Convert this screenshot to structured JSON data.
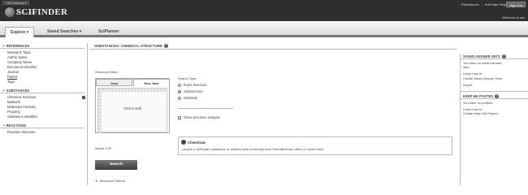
{
  "header": {
    "cas_chip": "CAS Solutions ▾",
    "logo_text": "SCIFINDER",
    "logo_sub": "A CAS SOLUTION",
    "links": [
      "Preferences",
      "SciFinder Help ▾"
    ],
    "separator": "|",
    "sign_out": "Sign Out",
    "welcome": "Welcome  liu yan"
  },
  "nav": {
    "tabs": [
      {
        "label": "Explore ▾",
        "active": true
      },
      {
        "label": "Saved Searches ▾",
        "active": false
      },
      {
        "label": "SciPlanner",
        "active": false
      }
    ]
  },
  "sidebar": {
    "references": {
      "title": "REFERENCES",
      "items": [
        "Research Topic",
        "Author Name",
        "Company Name",
        "Document Identifier",
        "Journal",
        "Patent",
        "Tags"
      ]
    },
    "substances": {
      "title": "SUBSTANCES",
      "items": [
        "Chemical Structure",
        "Markush",
        "Molecular Formula",
        "Property",
        "Substance Identifier"
      ]
    },
    "reactions": {
      "title": "REACTIONS",
      "items": [
        "Reaction Structure"
      ]
    }
  },
  "main": {
    "title": "SUBSTANCES: CHEMICAL STRUCTURE",
    "structure_editor_label": "Structure Editor:",
    "editor_tabs": [
      "Java",
      "Non-Java"
    ],
    "click_to_edit": "Click to Edit",
    "search_type_label": "Search Type:",
    "search_types": [
      {
        "label": "Exact Structure",
        "checked": false
      },
      {
        "label": "Substructure",
        "checked": true
      },
      {
        "label": "Similarity",
        "checked": false
      }
    ],
    "precision_label": "Show precision analysis",
    "chemdraw_title": "ChemDraw",
    "chemdraw_text": "Launch a SciFinder substance or reaction search directly from ChemBioDraw Ultra 14. Learn More",
    "import_cxf": "Import CXF",
    "search_button": "Search",
    "advanced_search": "Advanced Search"
  },
  "right_panel": {
    "saved_answer_sets": {
      "title": "SAVED ANSWER SETS",
      "empty_lines": [
        "You have no saved answer",
        "sets."
      ],
      "learn_how": "Learn how to:",
      "learn_link": "Create Saved Answer Sets",
      "import": "Import"
    },
    "keep_me_posted": {
      "title": "KEEP ME POSTED",
      "empty": "You have no profiles.",
      "learn_how": "Learn how to:",
      "learn_link": "Create Keep Me Posted"
    }
  }
}
